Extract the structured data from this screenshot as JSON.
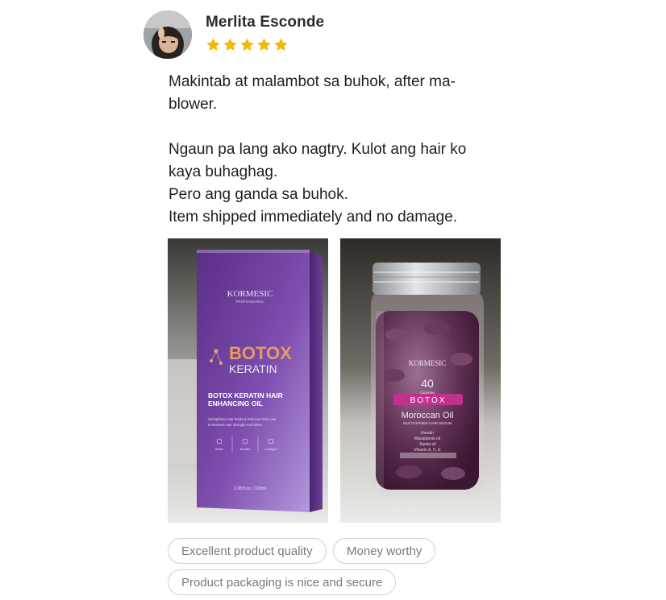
{
  "reviewer": {
    "name": "Merlita Esconde",
    "rating": 5,
    "rating_max": 5,
    "star_color": "#f5b800"
  },
  "review": {
    "lines": [
      "Makintab at malambot sa buhok, after ma-",
      "blower.",
      "Ngaun pa lang ako nagtry. Kulot ang hair ko",
      "kaya buhaghag.",
      "Pero ang ganda sa buhok.",
      "Item shipped immediately and no damage."
    ]
  },
  "photos": [
    {
      "brand": "KORMESIC",
      "brand_sub": "PROFESSIONAL",
      "title_big": "BOTOX",
      "title_small": "KERATIN",
      "product_name_1": "BOTOX KERATIN HAIR",
      "product_name_2": "ENHANCING OIL",
      "desc_1": "Strengthens Hair Roots & Reduces Hair Loss",
      "desc_2": "& Restores Hair Strength And Shine",
      "icon_1": "Shine",
      "icon_2": "Keratin",
      "icon_3": "Collagen",
      "volume": "3.38 fl.oz. / 100ml"
    },
    {
      "brand": "KORMESIC",
      "count": "40",
      "count_sub": "Capsules",
      "band": "BOTOX",
      "product_name": "Moroccan Oil",
      "product_sub": "MULTIVITAMIN HAIR SERUM",
      "ingredients_1": "Keratin",
      "ingredients_2": "Macadamia oil",
      "ingredients_3": "Jojoba oil",
      "ingredients_4": "Vitamin A, C, E"
    }
  ],
  "tags": [
    "Excellent product quality",
    "Money worthy",
    "Product packaging is nice and secure"
  ]
}
